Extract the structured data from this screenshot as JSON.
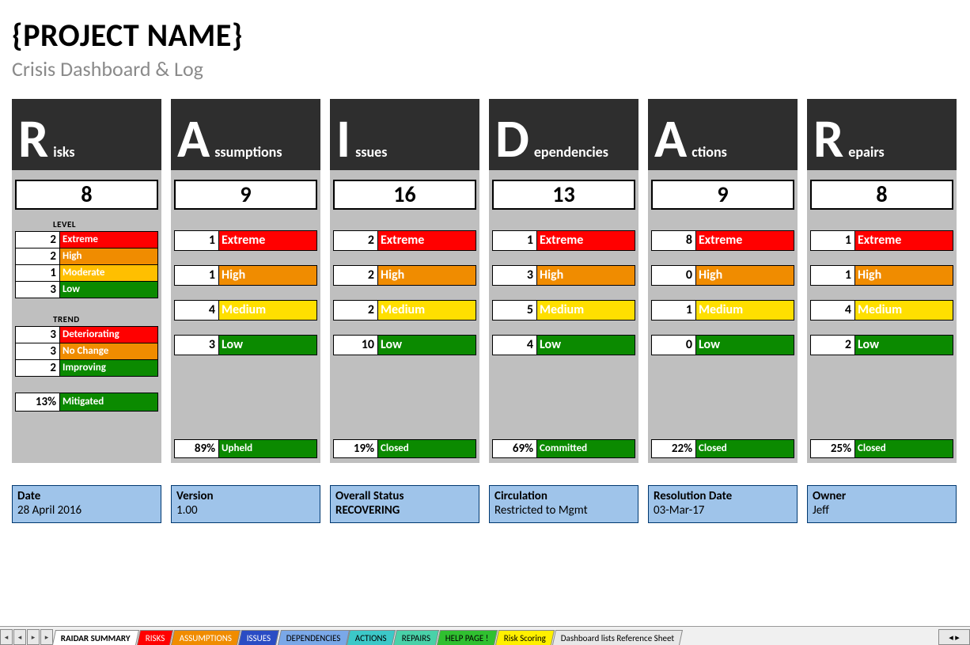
{
  "header": {
    "title": "{PROJECT NAME}",
    "subtitle": "Crisis Dashboard & Log"
  },
  "labels": {
    "level": "LEVEL",
    "trend": "TREND"
  },
  "cols": [
    {
      "letter": "R",
      "word": "isks",
      "total": "8",
      "levels": [
        {
          "n": "2",
          "label": "Extreme",
          "cls": "c-extreme"
        },
        {
          "n": "2",
          "label": "High",
          "cls": "c-high"
        },
        {
          "n": "1",
          "label": "Moderate",
          "cls": "c-moderate"
        },
        {
          "n": "3",
          "label": "Low",
          "cls": "c-low"
        }
      ],
      "trend": [
        {
          "n": "3",
          "label": "Deteriorating",
          "cls": "c-deter"
        },
        {
          "n": "3",
          "label": "No Change",
          "cls": "c-nochg"
        },
        {
          "n": "2",
          "label": "Improving",
          "cls": "c-improv"
        }
      ],
      "status": {
        "pct": "13%",
        "label": "Mitigated"
      }
    },
    {
      "letter": "A",
      "word": "ssumptions",
      "total": "9",
      "rows": [
        {
          "n": "1",
          "label": "Extreme",
          "cls": "c-extreme"
        },
        {
          "n": "1",
          "label": "High",
          "cls": "c-high"
        },
        {
          "n": "4",
          "label": "Medium",
          "cls": "c-medium"
        },
        {
          "n": "3",
          "label": "Low",
          "cls": "c-low"
        }
      ],
      "status": {
        "pct": "89%",
        "label": "Upheld"
      }
    },
    {
      "letter": "I",
      "word": "ssues",
      "total": "16",
      "rows": [
        {
          "n": "2",
          "label": "Extreme",
          "cls": "c-extreme"
        },
        {
          "n": "2",
          "label": "High",
          "cls": "c-high"
        },
        {
          "n": "2",
          "label": "Medium",
          "cls": "c-medium"
        },
        {
          "n": "10",
          "label": "Low",
          "cls": "c-low"
        }
      ],
      "status": {
        "pct": "19%",
        "label": "Closed"
      }
    },
    {
      "letter": "D",
      "word": "ependencies",
      "total": "13",
      "rows": [
        {
          "n": "1",
          "label": "Extreme",
          "cls": "c-extreme"
        },
        {
          "n": "3",
          "label": "High",
          "cls": "c-high"
        },
        {
          "n": "5",
          "label": "Medium",
          "cls": "c-medium"
        },
        {
          "n": "4",
          "label": "Low",
          "cls": "c-low"
        }
      ],
      "status": {
        "pct": "69%",
        "label": "Committed"
      }
    },
    {
      "letter": "A",
      "word": "ctions",
      "total": "9",
      "rows": [
        {
          "n": "8",
          "label": "Extreme",
          "cls": "c-extreme"
        },
        {
          "n": "0",
          "label": "High",
          "cls": "c-high"
        },
        {
          "n": "1",
          "label": "Medium",
          "cls": "c-medium"
        },
        {
          "n": "0",
          "label": "Low",
          "cls": "c-low"
        }
      ],
      "status": {
        "pct": "22%",
        "label": "Closed"
      }
    },
    {
      "letter": "R",
      "word": "epairs",
      "total": "8",
      "rows": [
        {
          "n": "1",
          "label": "Extreme",
          "cls": "c-extreme"
        },
        {
          "n": "1",
          "label": "High",
          "cls": "c-high"
        },
        {
          "n": "4",
          "label": "Medium",
          "cls": "c-medium"
        },
        {
          "n": "2",
          "label": "Low",
          "cls": "c-low"
        }
      ],
      "status": {
        "pct": "25%",
        "label": "Closed"
      }
    }
  ],
  "meta": [
    {
      "label": "Date",
      "value": "28 April 2016",
      "strong": false
    },
    {
      "label": "Version",
      "value": "1.00",
      "strong": false
    },
    {
      "label": "Overall Status",
      "value": "RECOVERING",
      "strong": true
    },
    {
      "label": "Circulation",
      "value": "Restricted to Mgmt",
      "strong": false
    },
    {
      "label": "Resolution Date",
      "value": "03-Mar-17",
      "strong": false
    },
    {
      "label": "Owner",
      "value": "Jeff",
      "strong": false
    }
  ],
  "tabs": [
    {
      "label": "RAIDAR SUMMARY",
      "cls": "active"
    },
    {
      "label": "RISKS",
      "cls": "t-red"
    },
    {
      "label": "ASSUMPTIONS",
      "cls": "t-orange"
    },
    {
      "label": "ISSUES",
      "cls": "t-blue"
    },
    {
      "label": "DEPENDENCIES",
      "cls": "t-lblue"
    },
    {
      "label": "ACTIONS",
      "cls": "t-cyan"
    },
    {
      "label": "REPAIRS",
      "cls": "t-teal"
    },
    {
      "label": "HELP PAGE !",
      "cls": "t-green"
    },
    {
      "label": "Risk Scoring",
      "cls": "t-yellow"
    },
    {
      "label": "Dashboard lists Reference Sheet",
      "cls": "t-plain"
    }
  ]
}
